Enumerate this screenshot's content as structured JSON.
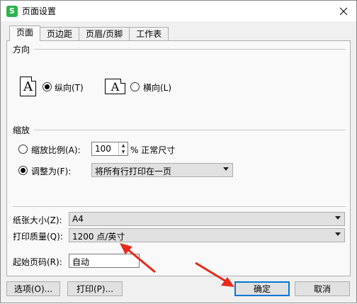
{
  "window": {
    "app_icon_letter": "S",
    "title": "页面设置"
  },
  "tabs": [
    {
      "label": "页面",
      "active": true
    },
    {
      "label": "页边距",
      "active": false
    },
    {
      "label": "页眉/页脚",
      "active": false
    },
    {
      "label": "工作表",
      "active": false
    }
  ],
  "orientation": {
    "section_label": "方向",
    "page_icon_glyph": "A",
    "portrait_label": "纵向(T)",
    "landscape_label": "横向(L)",
    "selected": "portrait"
  },
  "scaling": {
    "section_label": "缩放",
    "scale_label": "缩放比例(A):",
    "scale_value": "100",
    "scale_suffix": "% 正常尺寸",
    "fit_label": "调整为(F):",
    "fit_value": "将所有行打印在一页",
    "selected": "fit"
  },
  "paper": {
    "size_label": "纸张大小(Z):",
    "size_value": "A4",
    "quality_label": "打印质量(Q):",
    "quality_value": "1200 点/英寸",
    "first_page_label": "起始页码(R):",
    "first_page_value": "自动"
  },
  "buttons": {
    "options": "选项(O)...",
    "print": "打印(P)...",
    "ok": "确定",
    "cancel": "取消"
  },
  "annotation_color": "#e8291c"
}
